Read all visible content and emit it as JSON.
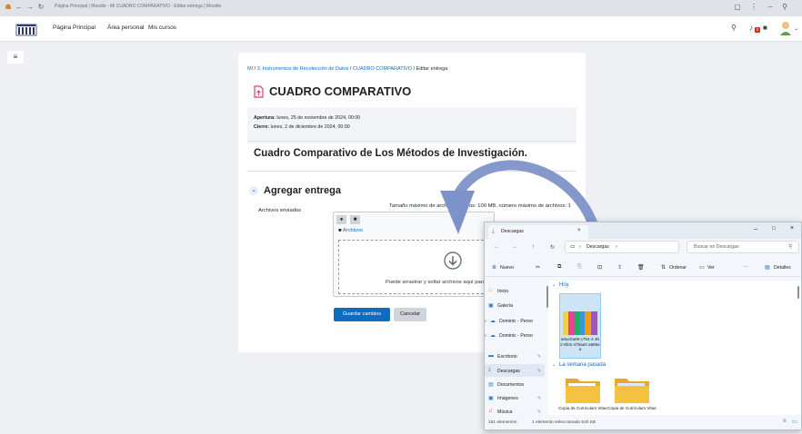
{
  "browser": {
    "tab_title": "Página Principal | Moodle - Mi CUADRO COMPARATIVO - Editar entrega | Moodle"
  },
  "navbar": {
    "links": [
      "Página Principal",
      "Área personal",
      "Mis cursos"
    ],
    "notification_count": "2"
  },
  "breadcrumb": {
    "items": [
      "MI",
      "3. Instrumentos de Recolección de Datos",
      "CUADRO COMPARATIVO",
      "Editar entrega"
    ],
    "sep": "/"
  },
  "assignment": {
    "title": "CUADRO COMPARATIVO",
    "opening_label": "Apertura:",
    "opening_value": "lunes, 25 de noviembre de 2024, 00:00",
    "closing_label": "Cierre:",
    "closing_value": "lunes, 2 de diciembre de 2024, 00:00",
    "heading": "Cuadro Comparativo de Los Métodos de Investigación."
  },
  "submission": {
    "section_title": "Agregar entrega",
    "files_label": "Archivos enviados",
    "max_size_text": "Tamaño máximo de archivos nuevos: 100 MB, número máximo de archivos: 1",
    "folder_label": "Archivos",
    "drop_text": "Puede arrastrar y soltar archivos aquí para añadirlos.",
    "save_button": "Guardar cambios",
    "cancel_button": "Cancelar"
  },
  "explorer": {
    "tab_title": "Descargas",
    "breadcrumb_label": "Descargas",
    "search_placeholder": "Buscar en Descargas",
    "toolbar": {
      "new": "Nuevo",
      "sort": "Ordenar",
      "view": "Ver",
      "details": "Detalles"
    },
    "sidebar_items": [
      "Inicio",
      "Galería",
      "Dominic - Perso",
      "Dominic - Perso",
      "Escritorio",
      "Descargas",
      "Documentos",
      "Imágenes",
      "Música"
    ],
    "group_today": "Hoy",
    "group_last_week": "La semana pasada",
    "selected_file": "a0ac0a09-c7b4-4 4b2-8fc5-47bae0 a865ea",
    "folders": [
      "Copia de Curriculum Vitae",
      "Copia de Curriculum Vitae"
    ],
    "status_count": "151 elementos",
    "status_selected": "1 elemento seleccionado  540 KB"
  },
  "colors": {
    "accent": "#0f6cbf",
    "assignment_icon": "#d6416a",
    "drag_arrow": "#7d92c9",
    "folder": "#f5c141",
    "selection": "#cce4f7"
  }
}
